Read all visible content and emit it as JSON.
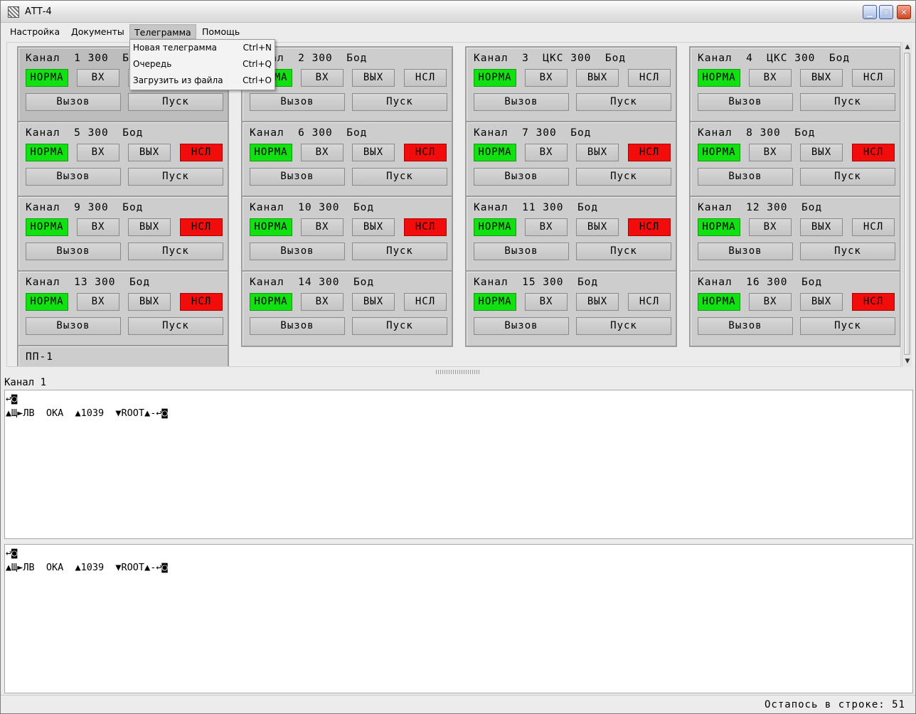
{
  "window": {
    "title": "АТТ-4"
  },
  "menubar": [
    "Настройка",
    "Документы",
    "Телеграмма",
    "Помощь"
  ],
  "dropdown": [
    {
      "label": "Новая телеграмма",
      "shortcut": "Ctrl+N"
    },
    {
      "label": "Очередь",
      "shortcut": "Ctrl+Q"
    },
    {
      "label": "Загрузить из файла",
      "shortcut": "Ctrl+O"
    }
  ],
  "buttons": {
    "norm": "НОРМА",
    "in": "ВХ",
    "out": "ВЫХ",
    "nsl": "НСЛ",
    "call": "Вызов",
    "start": "Пуск"
  },
  "channels": [
    {
      "title": "Канал  1 300  Бод",
      "nsl_alarm": false,
      "selected": true
    },
    {
      "title": "Канал  2 300  Бод",
      "nsl_alarm": false
    },
    {
      "title": "Канал  3  ЦКС 300  Бод",
      "nsl_alarm": false
    },
    {
      "title": "Канал  4  ЦКС 300  Бод",
      "nsl_alarm": false
    },
    {
      "title": "Канал  5 300  Бод",
      "nsl_alarm": true
    },
    {
      "title": "Канал  6 300  Бод",
      "nsl_alarm": true
    },
    {
      "title": "Канал  7 300  Бод",
      "nsl_alarm": true
    },
    {
      "title": "Канал  8 300  Бод",
      "nsl_alarm": true
    },
    {
      "title": "Канал  9 300  Бод",
      "nsl_alarm": true
    },
    {
      "title": "Канал  10 300  Бод",
      "nsl_alarm": true
    },
    {
      "title": "Канал  11 300  Бод",
      "nsl_alarm": true
    },
    {
      "title": "Канал  12 300  Бод",
      "nsl_alarm": false
    },
    {
      "title": "Канал  13 300  Бод",
      "nsl_alarm": true
    },
    {
      "title": "Канал  14 300  Бод",
      "nsl_alarm": false
    },
    {
      "title": "Канал  15 300  Бод",
      "nsl_alarm": false
    },
    {
      "title": "Канал  16 300  Бод",
      "nsl_alarm": true
    }
  ],
  "pp": {
    "title": "ПП-1"
  },
  "colors": {
    "norm_green": "#11e011",
    "nsl_red": "#f20c0c"
  },
  "output": {
    "channel_label": "Канал  1",
    "top_lines": [
      "↩◙",
      "▲Щ►ЛВ  ОКА  ▲1039  ▼ROOT▲-↩◙"
    ],
    "bottom_lines": [
      "↩◙",
      "▲Щ►ЛВ  ОКА  ▲1039  ▼ROOT▲-↩◙"
    ]
  },
  "status": {
    "remaining": "Остапось  в  строке:  51"
  }
}
